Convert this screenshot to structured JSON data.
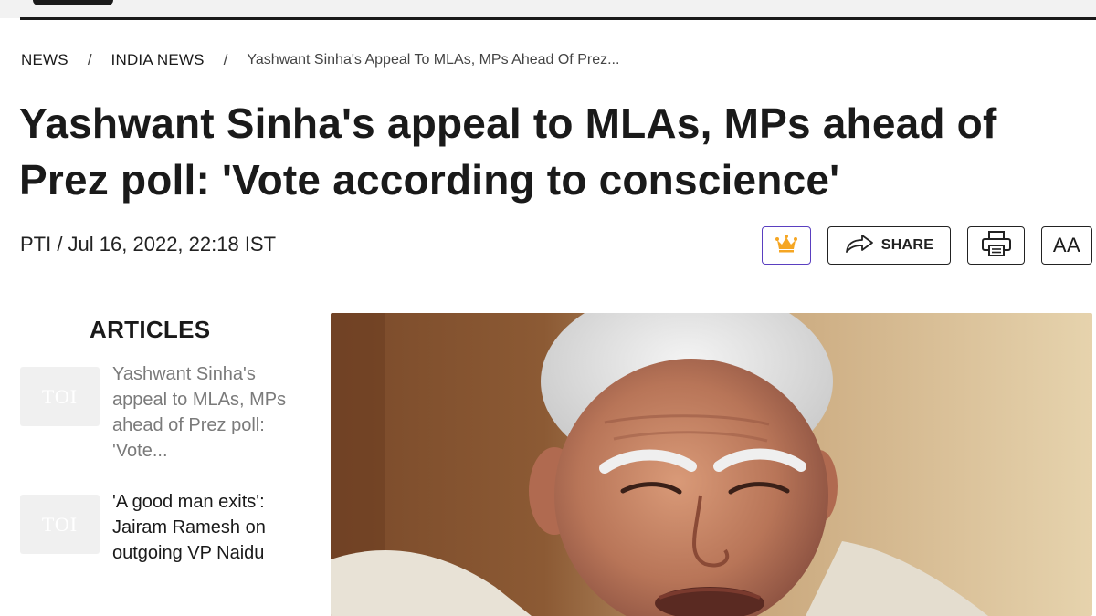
{
  "breadcrumb": {
    "items": [
      "NEWS",
      "INDIA NEWS"
    ],
    "separator": "/",
    "current": "Yashwant Sinha's Appeal To MLAs, MPs Ahead Of Prez..."
  },
  "article": {
    "headline": "Yashwant Sinha's appeal to MLAs, MPs ahead of Prez poll: 'Vote according to conscience'",
    "byline": "PTI / Jul 16, 2022, 22:18 IST",
    "hero_image_icon": "yashwant-sinha-photo"
  },
  "actions": {
    "prime_icon": "crown-icon",
    "share_label": "SHARE",
    "share_icon": "share-arrow-icon",
    "print_icon": "printer-icon",
    "font_size_label": "AA"
  },
  "sidebar": {
    "title": "ARTICLES",
    "thumb_text": "TOI",
    "items": [
      {
        "title": "Yashwant Sinha's appeal to MLAs, MPs ahead of Prez poll: 'Vote..."
      },
      {
        "title": "'A good man exits': Jairam Ramesh on outgoing VP Naidu"
      }
    ]
  },
  "colors": {
    "text": "#1a1a1a",
    "muted_text": "#7a7a7a",
    "prime_border": "#5a3fc0",
    "crown": "#f5a623"
  }
}
